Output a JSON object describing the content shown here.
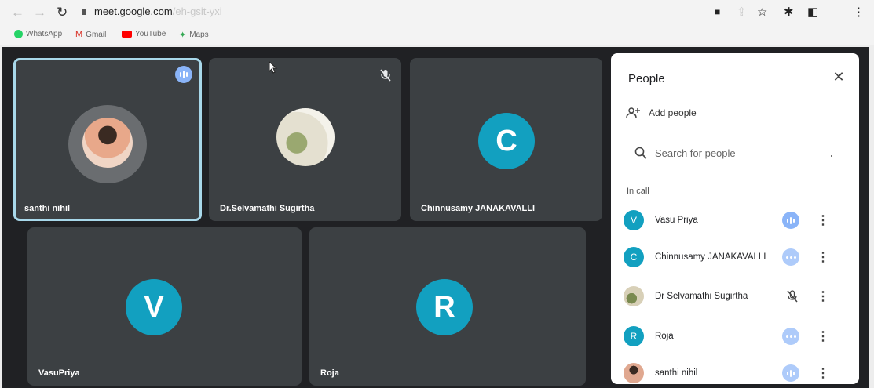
{
  "browser": {
    "url_main": "meet.google.com",
    "url_faded": "/eh-gsit-yxi",
    "bookmarks": [
      {
        "label": "WhatsApp",
        "color": "#25d366"
      },
      {
        "label": "Gmail",
        "color": "#d93025"
      },
      {
        "label": "YouTube",
        "color": "#ff0000"
      },
      {
        "label": "Maps",
        "color": "#34a853"
      }
    ]
  },
  "tiles": [
    {
      "name": "santhi nihil",
      "kind": "photo",
      "active": true,
      "status": "speaking"
    },
    {
      "name": "Dr.Selvamathi Sugirtha",
      "kind": "photo",
      "active": false,
      "status": "muted"
    },
    {
      "name": "Chinnusamy JANAKAVALLI",
      "kind": "letter",
      "letter": "C"
    },
    {
      "name": "VasuPriya",
      "kind": "letter",
      "letter": "V"
    },
    {
      "name": "Roja",
      "kind": "letter",
      "letter": "R"
    }
  ],
  "people_panel": {
    "title": "People",
    "add_people": "Add people",
    "search_placeholder": "Search for people",
    "section_label": "In call",
    "participants": [
      {
        "name": "Vasu Priya",
        "initial": "V",
        "status": "speaking"
      },
      {
        "name": "Chinnusamy JANAKAVALLI",
        "initial": "C",
        "status": "idle"
      },
      {
        "name": "Dr Selvamathi Sugirtha",
        "initial": "",
        "status": "muted"
      },
      {
        "name": "Roja",
        "initial": "R",
        "status": "idle"
      },
      {
        "name": "santhi nihil",
        "initial": "",
        "status": "speaking"
      }
    ]
  },
  "colors": {
    "avatar": "#12a0c0",
    "stage": "#202124",
    "tile": "#3c4043",
    "active_border": "#a8d8ea",
    "audio": "#8ab4f8"
  }
}
